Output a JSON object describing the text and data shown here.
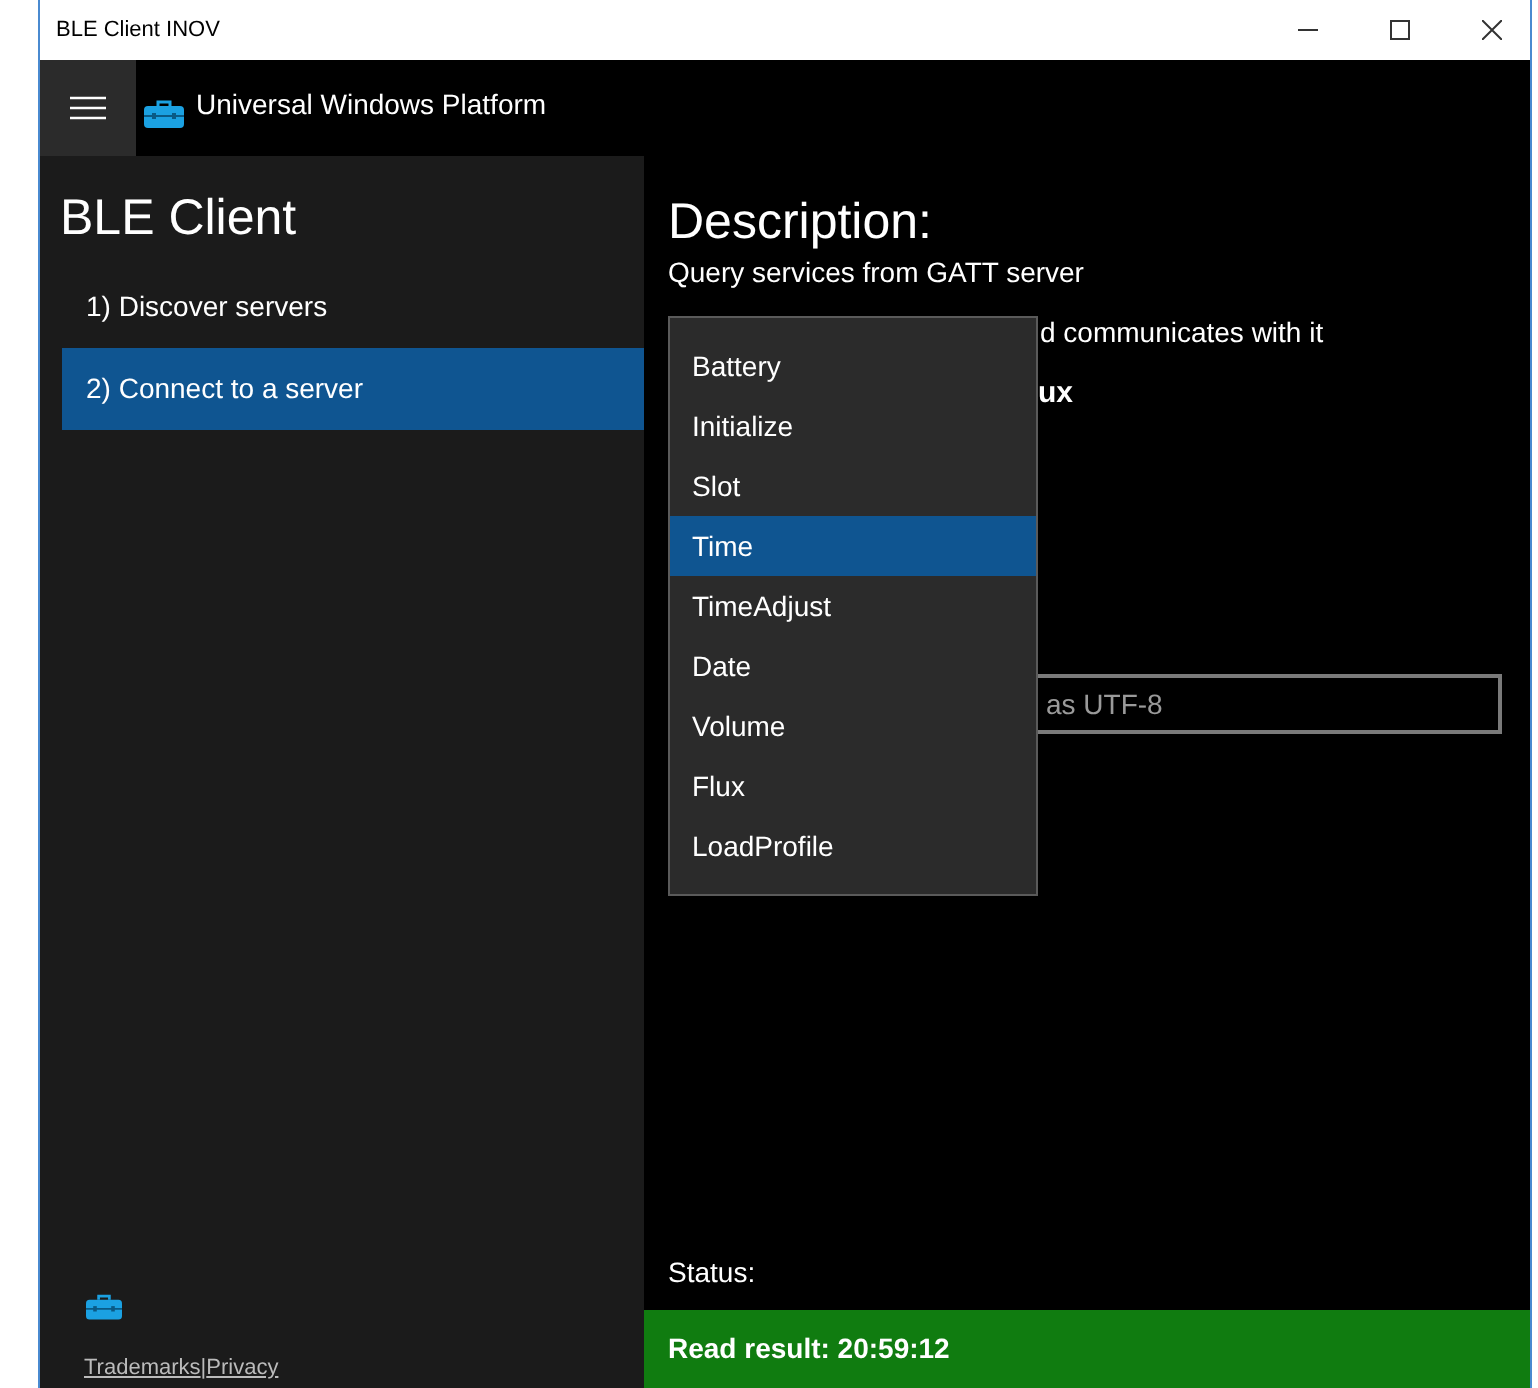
{
  "window": {
    "title": "BLE Client INOV"
  },
  "header": {
    "title": "Universal Windows Platform"
  },
  "sidebar": {
    "title": "BLE Client",
    "items": [
      {
        "label": "1) Discover servers",
        "selected": false
      },
      {
        "label": "2) Connect to a server",
        "selected": true
      }
    ],
    "footer_links": [
      "Trademarks",
      "Privacy"
    ],
    "separator": "|"
  },
  "content": {
    "heading": "Description:",
    "subtitle": "Query services from GATT server",
    "partial_line": "d communicates with it",
    "partial_bold": "ux",
    "input": {
      "placeholder": "as UTF-8"
    },
    "dropdown": {
      "items": [
        {
          "label": "Battery",
          "selected": false
        },
        {
          "label": "Initialize",
          "selected": false
        },
        {
          "label": "Slot",
          "selected": false
        },
        {
          "label": "Time",
          "selected": true
        },
        {
          "label": "TimeAdjust",
          "selected": false
        },
        {
          "label": "Date",
          "selected": false
        },
        {
          "label": "Volume",
          "selected": false
        },
        {
          "label": "Flux",
          "selected": false
        },
        {
          "label": "LoadProfile",
          "selected": false
        }
      ]
    },
    "status_label": "Status:",
    "status_message": "Read result: 20:59:12"
  }
}
